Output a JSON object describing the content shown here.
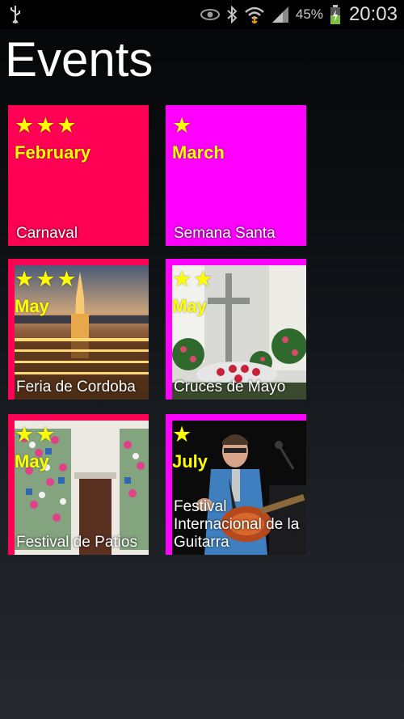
{
  "status_bar": {
    "battery_percent": "45%",
    "time": "20:03",
    "icons": [
      "usb-icon",
      "eye-icon",
      "bluetooth-icon",
      "wifi-icon",
      "signal-icon",
      "battery-charging-icon"
    ]
  },
  "page": {
    "title": "Events"
  },
  "colors": {
    "red": "#ff0055",
    "magenta": "#ff00ff",
    "star": "#ffff00"
  },
  "events": [
    {
      "stars": "★★★",
      "rating": 3,
      "month": "February",
      "name": "Carnaval"
    },
    {
      "stars": "★",
      "rating": 1,
      "month": "March",
      "name": "Semana Santa"
    },
    {
      "stars": "★★★",
      "rating": 3,
      "month": "May",
      "name": "Feria de Cordoba"
    },
    {
      "stars": "★★",
      "rating": 2,
      "month": "May",
      "name": "Cruces de Mayo"
    },
    {
      "stars": "★★",
      "rating": 2,
      "month": "May",
      "name": "Festival de Patios"
    },
    {
      "stars": "★",
      "rating": 1,
      "month": "July",
      "name": "Festival Internacional de la Guitarra"
    }
  ]
}
